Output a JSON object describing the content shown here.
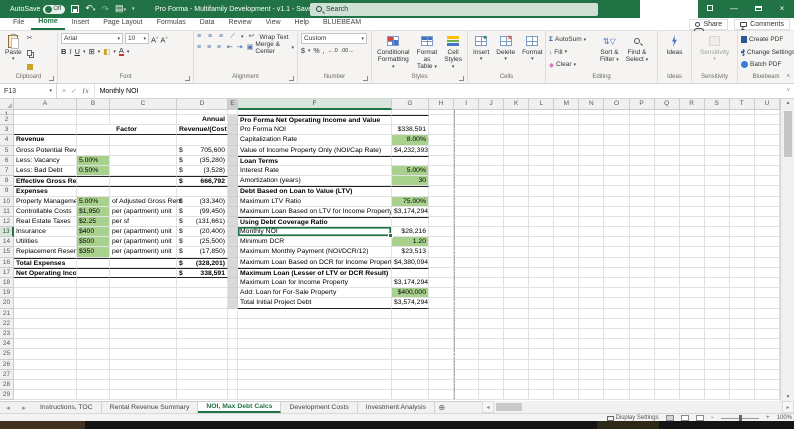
{
  "colors": {
    "excel_green": "#217346",
    "input_fill": "#a9d18e",
    "spacer_fill": "#d9d9d9",
    "search_fill": "#cfe0d5"
  },
  "title_bar": {
    "autosave_label": "AutoSave",
    "autosave_state": "Off",
    "title": "Pro Forma - Multifamily Development - v1.1 - Saved",
    "search_placeholder": "Search"
  },
  "ribbon_tabs": {
    "items": [
      "File",
      "Home",
      "Insert",
      "Page Layout",
      "Formulas",
      "Data",
      "Review",
      "View",
      "Help",
      "BLUEBEAM"
    ],
    "active": "Home",
    "share": "Share",
    "comments": "Comments"
  },
  "ribbon": {
    "clipboard": {
      "paste": "Paste",
      "label": "Clipboard"
    },
    "font": {
      "family": "Arial",
      "size": "10",
      "label": "Font"
    },
    "alignment": {
      "wrap": "Wrap Text",
      "merge": "Merge & Center",
      "label": "Alignment"
    },
    "number": {
      "format": "Custom",
      "label": "Number"
    },
    "styles": {
      "conditional_1": "Conditional",
      "conditional_2": "Formatting",
      "table_1": "Format as",
      "table_2": "Table",
      "cell_1": "Cell",
      "cell_2": "Styles",
      "label": "Styles"
    },
    "cells": {
      "insert": "Insert",
      "delete": "Delete",
      "format": "Format",
      "label": "Cells"
    },
    "editing": {
      "autosum": "AutoSum",
      "fill": "Fill",
      "clear": "Clear",
      "sort_1": "Sort &",
      "sort_2": "Filter",
      "find_1": "Find &",
      "find_2": "Select",
      "label": "Editing"
    },
    "ideas": {
      "button": "Ideas",
      "label": "Ideas"
    },
    "sensitivity": {
      "button": "Sensitivity",
      "label": "Sensitivity"
    },
    "bluebeam": {
      "create": "Create PDF",
      "settings": "Change Settings",
      "batch": "Batch PDF",
      "label": "Bluebeam"
    }
  },
  "formula_bar": {
    "name_box": "F13",
    "content": "Monthly NOI"
  },
  "grid": {
    "columns": [
      "A",
      "B",
      "C",
      "D",
      "E",
      "F",
      "G",
      "H",
      "I",
      "J",
      "K",
      "L",
      "M",
      "N",
      "O",
      "P",
      "Q",
      "R",
      "S",
      "T",
      "U"
    ],
    "selected_cell": "F13",
    "selected_column": "F",
    "selected_row": 13,
    "rows_visible": 29,
    "left_table": {
      "header": {
        "annual": "Annual",
        "factor": "Factor",
        "revenue_cost": "Revenue/(Cost)"
      },
      "rows": [
        {
          "row": 4,
          "label": "Revenue",
          "bold": true
        },
        {
          "row": 5,
          "label": "Gross Potential Revenue",
          "currency": "$",
          "amount": "705,600"
        },
        {
          "row": 6,
          "label": "Less: Vacancy",
          "factor": "5.00%",
          "currency": "$",
          "amount": "(35,280)"
        },
        {
          "row": 7,
          "label": "Less: Bad Debt",
          "factor": "0.50%",
          "currency": "$",
          "amount": "(3,528)"
        },
        {
          "row": 8,
          "label": "Effective Gross Revenue",
          "bold": true,
          "currency": "$",
          "amount": "666,792",
          "top": true
        },
        {
          "row": 9,
          "label": "Expenses",
          "bold": true,
          "top": true
        },
        {
          "row": 10,
          "label": "Property Management",
          "factor": "5.00%",
          "unit": "of Adjusted Gross Rent",
          "currency": "$",
          "amount": "(33,340)"
        },
        {
          "row": 11,
          "label": "Controllable Costs",
          "factor": "$1,950",
          "unit": "per (apartment) unit",
          "currency": "$",
          "amount": "(99,450)"
        },
        {
          "row": 12,
          "label": "Real Estate Taxes",
          "factor": "$2.25",
          "unit": "per sf",
          "currency": "$",
          "amount": "(131,661)"
        },
        {
          "row": 13,
          "label": "Insurance",
          "factor": "$400",
          "unit": "per (apartment) unit",
          "currency": "$",
          "amount": "(20,400)"
        },
        {
          "row": 14,
          "label": "Utilities",
          "factor": "$500",
          "unit": "per (apartment) unit",
          "currency": "$",
          "amount": "(25,500)"
        },
        {
          "row": 15,
          "label": "Replacement Reserve",
          "factor": "$350",
          "unit": "per (apartment) unit",
          "currency": "$",
          "amount": "(17,850)"
        },
        {
          "row": 16,
          "label": "Total Expenses",
          "bold": true,
          "currency": "$",
          "amount": "(328,201)",
          "top": true
        },
        {
          "row": 17,
          "label": "Net Operating Income",
          "bold": true,
          "currency": "$",
          "amount": "338,591",
          "top": true,
          "bottom": true
        }
      ]
    },
    "right_table": {
      "rows": [
        {
          "row": 2,
          "label": "Pro Forma Net Operating Income and Value",
          "bold": true,
          "top": true
        },
        {
          "row": 3,
          "label": "Pro Forma NOI",
          "value": "$338,591"
        },
        {
          "row": 4,
          "label": "Capitalization Rate",
          "value": "8.00%",
          "green": true
        },
        {
          "row": 5,
          "label": "Value of Income Property Only (NOI/Cap Rate)",
          "value": "$4,232,393"
        },
        {
          "row": 6,
          "label": "Loan Terms",
          "bold": true,
          "top": true
        },
        {
          "row": 7,
          "label": "Interest Rate",
          "value": "5.00%",
          "green": true
        },
        {
          "row": 8,
          "label": "Amortization (years)",
          "value": "30",
          "green": true
        },
        {
          "row": 9,
          "label": "Debt Based on Loan to Value (LTV)",
          "bold": true,
          "top": true
        },
        {
          "row": 10,
          "label": "Maximum LTV Ratio",
          "value": "75.00%",
          "green": true
        },
        {
          "row": 11,
          "label": "Maximum Loan Based on LTV for Income Property",
          "value": "$3,174,294"
        },
        {
          "row": 12,
          "label": "Using Debt Coverage Ratio",
          "bold": true,
          "top": true
        },
        {
          "row": 13,
          "label": "Monthly NOI",
          "value": "$28,216",
          "selected": true
        },
        {
          "row": 14,
          "label": "Minimum DCR",
          "value": "1.20",
          "green": true
        },
        {
          "row": 15,
          "label": "Maximum Monthly Payment (NOI/DCR/12)",
          "value": "$23,513"
        },
        {
          "row": 16,
          "label": "Maximum Loan Based on DCR for Income Property",
          "value": "$4,380,094"
        },
        {
          "row": 17,
          "label": "Maximum Loan (Lesser of LTV or DCR Result)",
          "bold": true,
          "top": true
        },
        {
          "row": 18,
          "label": "Maximum Loan for Income Property",
          "value": "$3,174,294"
        },
        {
          "row": 19,
          "label": "Add: Loan for For-Sale Property",
          "value": "$400,000",
          "green": true
        },
        {
          "row": 20,
          "label": "Total Initial Project Debt",
          "value": "$3,574,294",
          "bottom": true
        }
      ]
    }
  },
  "sheet_tabs": {
    "tabs": [
      "Instructions, TOC",
      "Rental Revenue Summary",
      "NOI, Max Debt Calcs",
      "Development Costs",
      "Investment Analysis"
    ],
    "active": "NOI, Max Debt Calcs"
  },
  "status_bar": {
    "display_settings": "Display Settings",
    "zoom_level": "100%"
  }
}
